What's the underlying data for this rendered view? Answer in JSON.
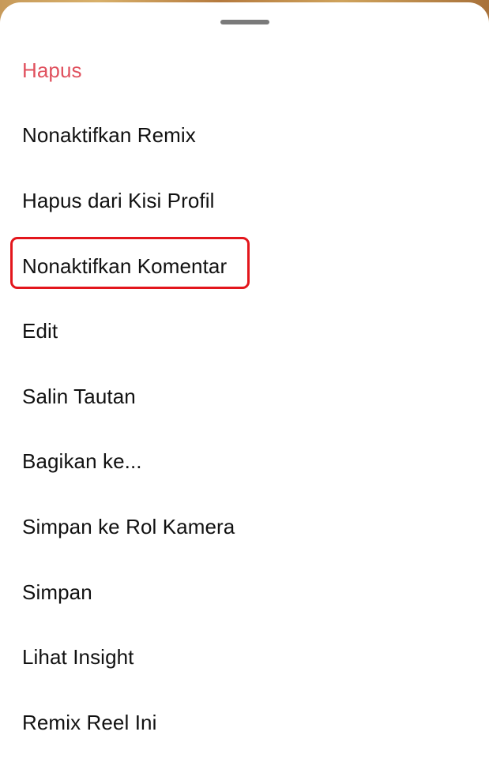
{
  "sheet": {
    "items": [
      {
        "label": "Hapus",
        "style": "danger"
      },
      {
        "label": "Nonaktifkan Remix"
      },
      {
        "label": "Hapus dari Kisi Profil"
      },
      {
        "label": "Nonaktifkan Komentar",
        "highlighted": true
      },
      {
        "label": "Edit"
      },
      {
        "label": "Salin Tautan"
      },
      {
        "label": "Bagikan ke..."
      },
      {
        "label": "Simpan ke Rol Kamera"
      },
      {
        "label": "Simpan"
      },
      {
        "label": "Lihat Insight"
      },
      {
        "label": "Remix Reel Ini"
      }
    ]
  },
  "colors": {
    "danger_text": "#e0515e",
    "highlight_border": "#e3161c",
    "text": "#111111",
    "handle": "#7a7a7a"
  }
}
